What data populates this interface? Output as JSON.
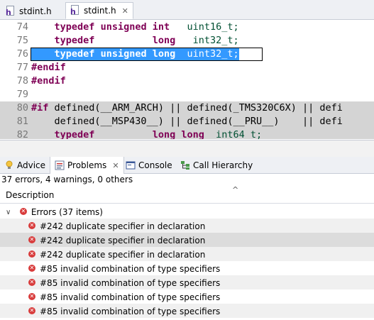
{
  "editor_tabs": [
    {
      "label": "stdint.h",
      "icon": "header-file-icon"
    },
    {
      "label": "stdint.h",
      "icon": "header-file-icon",
      "close": "✕"
    }
  ],
  "code_lines": [
    {
      "num": "74",
      "parts": [
        {
          "t": "    "
        },
        {
          "t": "typedef",
          "c": "kw"
        },
        {
          "t": " "
        },
        {
          "t": "unsigned",
          "c": "kw"
        },
        {
          "t": " "
        },
        {
          "t": "int",
          "c": "kw"
        },
        {
          "t": "   uint16_t;",
          "c": "ty"
        }
      ]
    },
    {
      "num": "75",
      "parts": [
        {
          "t": "    "
        },
        {
          "t": "typedef",
          "c": "kw"
        },
        {
          "t": "          "
        },
        {
          "t": "long",
          "c": "kw"
        },
        {
          "t": "   int32_t;",
          "c": "ty"
        }
      ]
    },
    {
      "num": "76",
      "parts": [
        {
          "t": "    "
        },
        {
          "t": "typedef",
          "c": "kw"
        },
        {
          "t": " "
        },
        {
          "t": "unsigned",
          "c": "kw"
        },
        {
          "t": " "
        },
        {
          "t": "long",
          "c": "kw"
        },
        {
          "t": "  uint32_t;",
          "c": "ty"
        }
      ]
    },
    {
      "num": "77",
      "parts": [
        {
          "t": "#endif",
          "c": "kw"
        }
      ]
    },
    {
      "num": "78",
      "parts": [
        {
          "t": "#endif",
          "c": "kw"
        }
      ]
    },
    {
      "num": "79",
      "parts": []
    },
    {
      "num": "80",
      "parts": [
        {
          "t": "#if",
          "c": "kw"
        },
        {
          "t": " defined(__ARM_ARCH) || defined(_TMS320C6X) || defi"
        }
      ]
    },
    {
      "num": "81",
      "parts": [
        {
          "t": "    defined(__MSP430__) || defined(__PRU__)    || defi"
        }
      ]
    },
    {
      "num": "82",
      "parts": [
        {
          "t": "    "
        },
        {
          "t": "typedef",
          "c": "kw"
        },
        {
          "t": "          "
        },
        {
          "t": "long long",
          "c": "kw"
        },
        {
          "t": "  int64_t;",
          "c": "ty"
        }
      ]
    }
  ],
  "view_tabs": [
    {
      "label": "Advice",
      "icon": "lightbulb-icon"
    },
    {
      "label": "Problems",
      "icon": "problems-icon",
      "close": "✕"
    },
    {
      "label": "Console",
      "icon": "console-icon"
    },
    {
      "label": "Call Hierarchy",
      "icon": "call-hierarchy-icon"
    }
  ],
  "problems": {
    "summary": "37 errors, 4 warnings, 0 others",
    "column_header": "Description",
    "group_label": "Errors (37 items)",
    "items": [
      "#242 duplicate specifier in declaration",
      "#242 duplicate specifier in declaration",
      "#242 duplicate specifier in declaration",
      "#85 invalid combination of type specifiers",
      "#85 invalid combination of type specifiers",
      "#85 invalid combination of type specifiers",
      "#85 invalid combination of type specifiers"
    ]
  },
  "colors": {
    "keyword": "#7f0055",
    "selection": "#3399ff",
    "error": "#d83b3b"
  }
}
